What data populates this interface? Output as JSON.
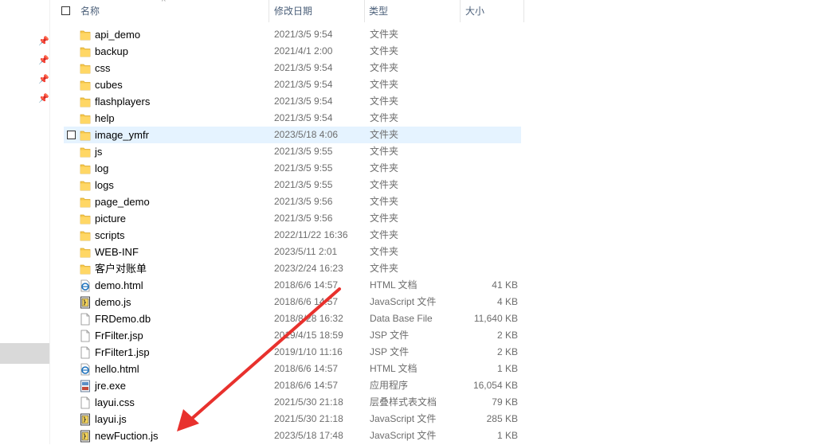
{
  "header": {
    "name": "名称",
    "date": "修改日期",
    "type": "类型",
    "size": "大小"
  },
  "files": [
    {
      "name": "api_demo",
      "date": "2021/3/5 9:54",
      "type": "文件夹",
      "size": "",
      "icon": "folder-icon"
    },
    {
      "name": "backup",
      "date": "2021/4/1 2:00",
      "type": "文件夹",
      "size": "",
      "icon": "folder-icon"
    },
    {
      "name": "css",
      "date": "2021/3/5 9:54",
      "type": "文件夹",
      "size": "",
      "icon": "folder-icon"
    },
    {
      "name": "cubes",
      "date": "2021/3/5 9:54",
      "type": "文件夹",
      "size": "",
      "icon": "folder-icon"
    },
    {
      "name": "flashplayers",
      "date": "2021/3/5 9:54",
      "type": "文件夹",
      "size": "",
      "icon": "folder-icon"
    },
    {
      "name": "help",
      "date": "2021/3/5 9:54",
      "type": "文件夹",
      "size": "",
      "icon": "folder-icon"
    },
    {
      "name": "image_ymfr",
      "date": "2023/5/18 4:06",
      "type": "文件夹",
      "size": "",
      "icon": "folder-icon",
      "selected": true
    },
    {
      "name": "js",
      "date": "2021/3/5 9:55",
      "type": "文件夹",
      "size": "",
      "icon": "folder-icon"
    },
    {
      "name": "log",
      "date": "2021/3/5 9:55",
      "type": "文件夹",
      "size": "",
      "icon": "folder-icon"
    },
    {
      "name": "logs",
      "date": "2021/3/5 9:55",
      "type": "文件夹",
      "size": "",
      "icon": "folder-icon"
    },
    {
      "name": "page_demo",
      "date": "2021/3/5 9:56",
      "type": "文件夹",
      "size": "",
      "icon": "folder-icon"
    },
    {
      "name": "picture",
      "date": "2021/3/5 9:56",
      "type": "文件夹",
      "size": "",
      "icon": "folder-icon"
    },
    {
      "name": "scripts",
      "date": "2022/11/22 16:36",
      "type": "文件夹",
      "size": "",
      "icon": "folder-icon"
    },
    {
      "name": "WEB-INF",
      "date": "2023/5/11 2:01",
      "type": "文件夹",
      "size": "",
      "icon": "folder-icon"
    },
    {
      "name": "客户对账单",
      "date": "2023/2/24 16:23",
      "type": "文件夹",
      "size": "",
      "icon": "folder-icon"
    },
    {
      "name": "demo.html",
      "date": "2018/6/6 14:57",
      "type": "HTML 文档",
      "size": "41 KB",
      "icon": "html-file-icon"
    },
    {
      "name": "demo.js",
      "date": "2018/6/6 14:57",
      "type": "JavaScript 文件",
      "size": "4 KB",
      "icon": "js-file-icon"
    },
    {
      "name": "FRDemo.db",
      "date": "2018/8/28 16:32",
      "type": "Data Base File",
      "size": "11,640 KB",
      "icon": "generic-file-icon"
    },
    {
      "name": "FrFilter.jsp",
      "date": "2019/4/15 18:59",
      "type": "JSP 文件",
      "size": "2 KB",
      "icon": "generic-file-icon"
    },
    {
      "name": "FrFilter1.jsp",
      "date": "2019/1/10 11:16",
      "type": "JSP 文件",
      "size": "2 KB",
      "icon": "generic-file-icon"
    },
    {
      "name": "hello.html",
      "date": "2018/6/6 14:57",
      "type": "HTML 文档",
      "size": "1 KB",
      "icon": "html-file-icon"
    },
    {
      "name": "jre.exe",
      "date": "2018/6/6 14:57",
      "type": "应用程序",
      "size": "16,054 KB",
      "icon": "exe-file-icon"
    },
    {
      "name": "layui.css",
      "date": "2021/5/30 21:18",
      "type": "层叠样式表文档",
      "size": "79 KB",
      "icon": "generic-file-icon"
    },
    {
      "name": "layui.js",
      "date": "2021/5/30 21:18",
      "type": "JavaScript 文件",
      "size": "285 KB",
      "icon": "js-file-icon"
    },
    {
      "name": "newFuction.js",
      "date": "2023/5/18 17:48",
      "type": "JavaScript 文件",
      "size": "1 KB",
      "icon": "js-file-icon"
    }
  ],
  "colors": {
    "selection": "#e5f3ff",
    "folder": "#f7c94b",
    "arrow": "#e8312d",
    "header_text": "#4c607a"
  }
}
